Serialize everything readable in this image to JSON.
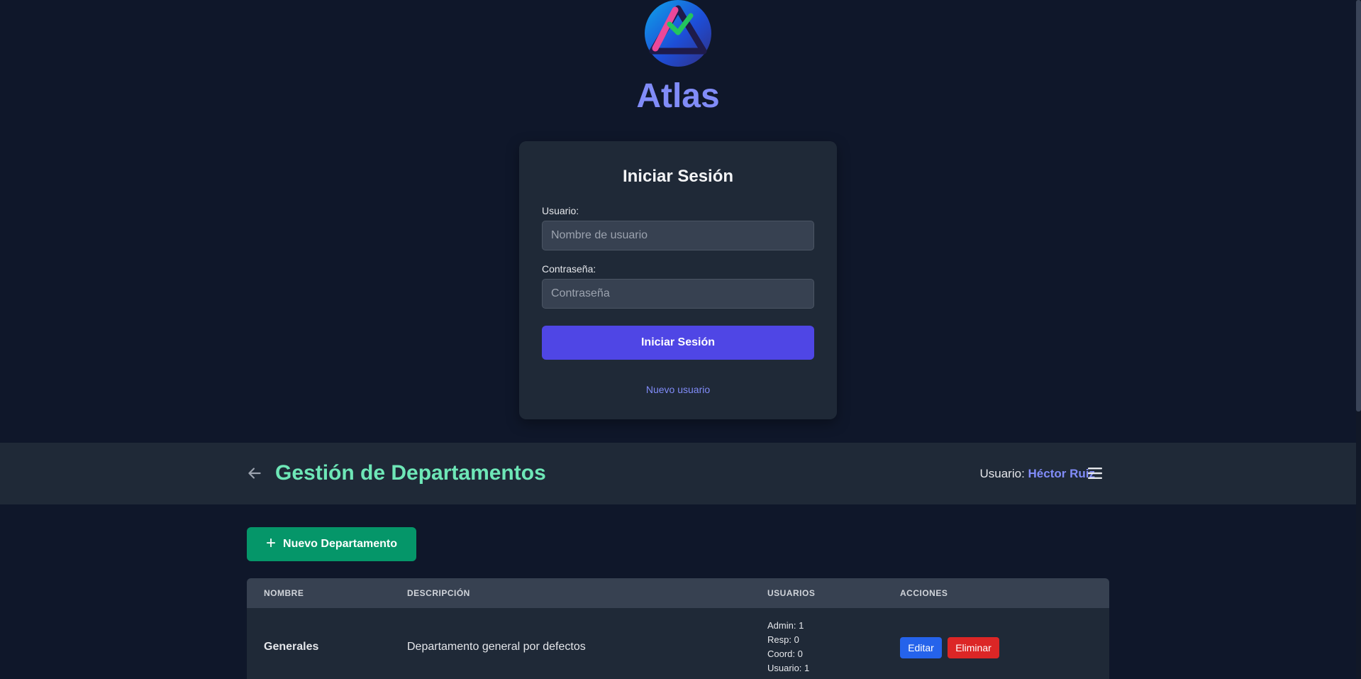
{
  "brand": {
    "name": "Atlas",
    "logo_icon": "atlas-triangle-check-logo"
  },
  "login": {
    "heading": "Iniciar Sesión",
    "username_label": "Usuario:",
    "username_placeholder": "Nombre de usuario",
    "password_label": "Contraseña:",
    "password_placeholder": "Contraseña",
    "submit_label": "Iniciar Sesión",
    "new_user_link": "Nuevo usuario"
  },
  "header": {
    "back_icon": "arrow-left-icon",
    "title": "Gestión de Departamentos",
    "user_prefix": "Usuario:",
    "user_name": "Héctor Ruiz",
    "menu_icon": "hamburger-menu-icon"
  },
  "toolbar": {
    "new_department_label": "Nuevo Departamento",
    "new_department_icon": "plus-icon"
  },
  "table": {
    "columns": [
      "NOMBRE",
      "DESCRIPCIÓN",
      "USUARIOS",
      "ACCIONES"
    ],
    "rows": [
      {
        "name": "Generales",
        "description": "Departamento general por defectos",
        "users": [
          "Admin: 1",
          "Resp: 0",
          "Coord: 0",
          "Usuario: 1"
        ],
        "edit_label": "Editar",
        "delete_label": "Eliminar"
      }
    ]
  },
  "colors": {
    "background": "#0f172a",
    "card": "#1f2937",
    "accent": "#4f46e5",
    "brand_text": "#818cf8",
    "title_green": "#6ee7b7",
    "success_button": "#059669",
    "edit_blue": "#2563eb",
    "delete_red": "#dc2626"
  }
}
